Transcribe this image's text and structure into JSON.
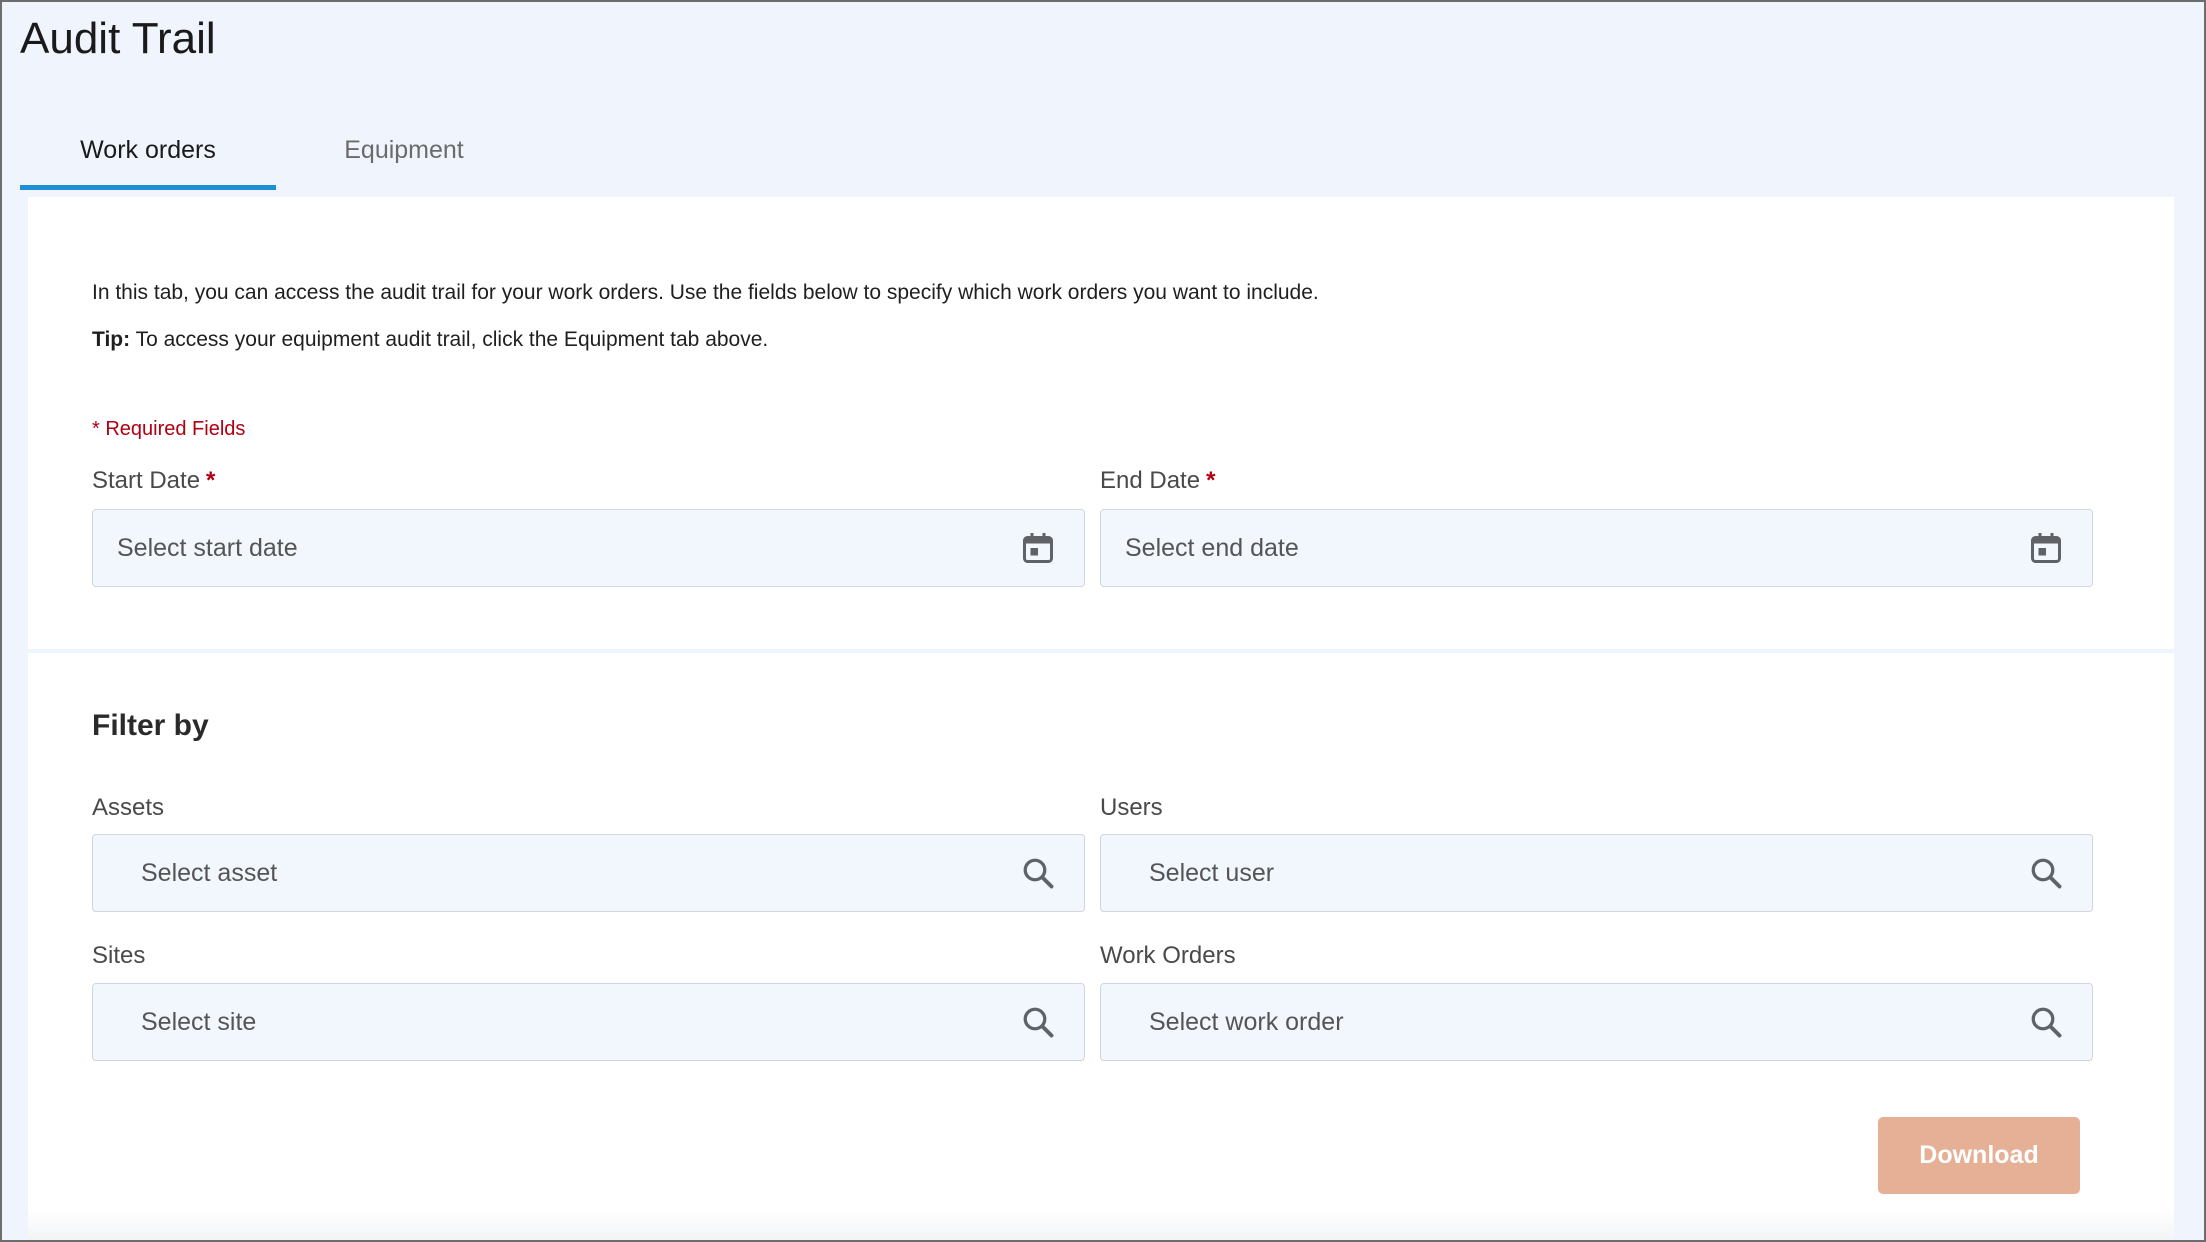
{
  "page": {
    "title": "Audit Trail"
  },
  "tabs": [
    {
      "label": "Work orders",
      "active": true
    },
    {
      "label": "Equipment",
      "active": false
    }
  ],
  "intro": {
    "text": "In this tab, you can access the audit trail for your work orders. Use the fields below to specify which work orders you want to include.",
    "tip_label": "Tip:",
    "tip_text": " To access your equipment audit trail, click the Equipment tab above.",
    "required_note": "* Required Fields"
  },
  "dates": {
    "start": {
      "label": "Start Date",
      "required_mark": "*",
      "placeholder": "Select start date",
      "icon": "calendar-icon"
    },
    "end": {
      "label": "End Date",
      "required_mark": "*",
      "placeholder": "Select end date",
      "icon": "calendar-icon"
    }
  },
  "filters": {
    "title": "Filter by",
    "assets": {
      "label": "Assets",
      "placeholder": "Select asset",
      "icon": "search-icon"
    },
    "users": {
      "label": "Users",
      "placeholder": "Select user",
      "icon": "search-icon"
    },
    "sites": {
      "label": "Sites",
      "placeholder": "Select site",
      "icon": "search-icon"
    },
    "work_orders": {
      "label": "Work Orders",
      "placeholder": "Select work order",
      "icon": "search-icon"
    }
  },
  "actions": {
    "download_label": "Download"
  },
  "colors": {
    "background": "#f0f5fd",
    "tab_accent": "#1e8fd6",
    "required": "#b00012",
    "download_button": "#e6b096",
    "field_background": "#f2f6fd"
  }
}
